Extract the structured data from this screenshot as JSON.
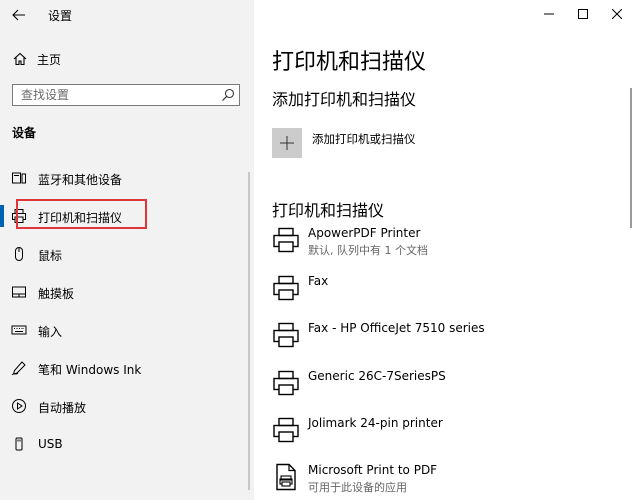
{
  "window": {
    "title": "设置"
  },
  "sidebar": {
    "home_label": "主页",
    "search_placeholder": "查找设置",
    "section_title": "设备",
    "items": [
      {
        "label": "蓝牙和其他设备",
        "icon": "bluetooth-devices-icon"
      },
      {
        "label": "打印机和扫描仪",
        "icon": "printer-icon",
        "selected": true
      },
      {
        "label": "鼠标",
        "icon": "mouse-icon"
      },
      {
        "label": "触摸板",
        "icon": "touchpad-icon"
      },
      {
        "label": "输入",
        "icon": "keyboard-icon"
      },
      {
        "label": "笔和 Windows Ink",
        "icon": "pen-icon"
      },
      {
        "label": "自动播放",
        "icon": "autoplay-icon"
      },
      {
        "label": "USB",
        "icon": "usb-icon"
      }
    ]
  },
  "main": {
    "title": "打印机和扫描仪",
    "add_section_title": "添加打印机和扫描仪",
    "add_button_label": "添加打印机或扫描仪",
    "list_section_title": "打印机和扫描仪",
    "printers": [
      {
        "name": "ApowerPDF Printer",
        "status": "默认, 队列中有 1 个文档",
        "icon": "printer-icon"
      },
      {
        "name": "Fax",
        "status": "",
        "icon": "printer-icon"
      },
      {
        "name": "Fax - HP OfficeJet 7510 series",
        "status": "",
        "icon": "printer-icon"
      },
      {
        "name": "Generic 26C-7SeriesPS",
        "status": "",
        "icon": "printer-icon"
      },
      {
        "name": "Jolimark 24-pin printer",
        "status": "",
        "icon": "printer-icon"
      },
      {
        "name": "Microsoft Print to PDF",
        "status": "可用于此设备的应用",
        "icon": "pdf-printer-icon"
      }
    ]
  },
  "colors": {
    "accent": "#0063b1",
    "highlight_box": "#e0353a",
    "sidebar_bg": "#f2f2f2",
    "add_tile": "#cccccc"
  }
}
